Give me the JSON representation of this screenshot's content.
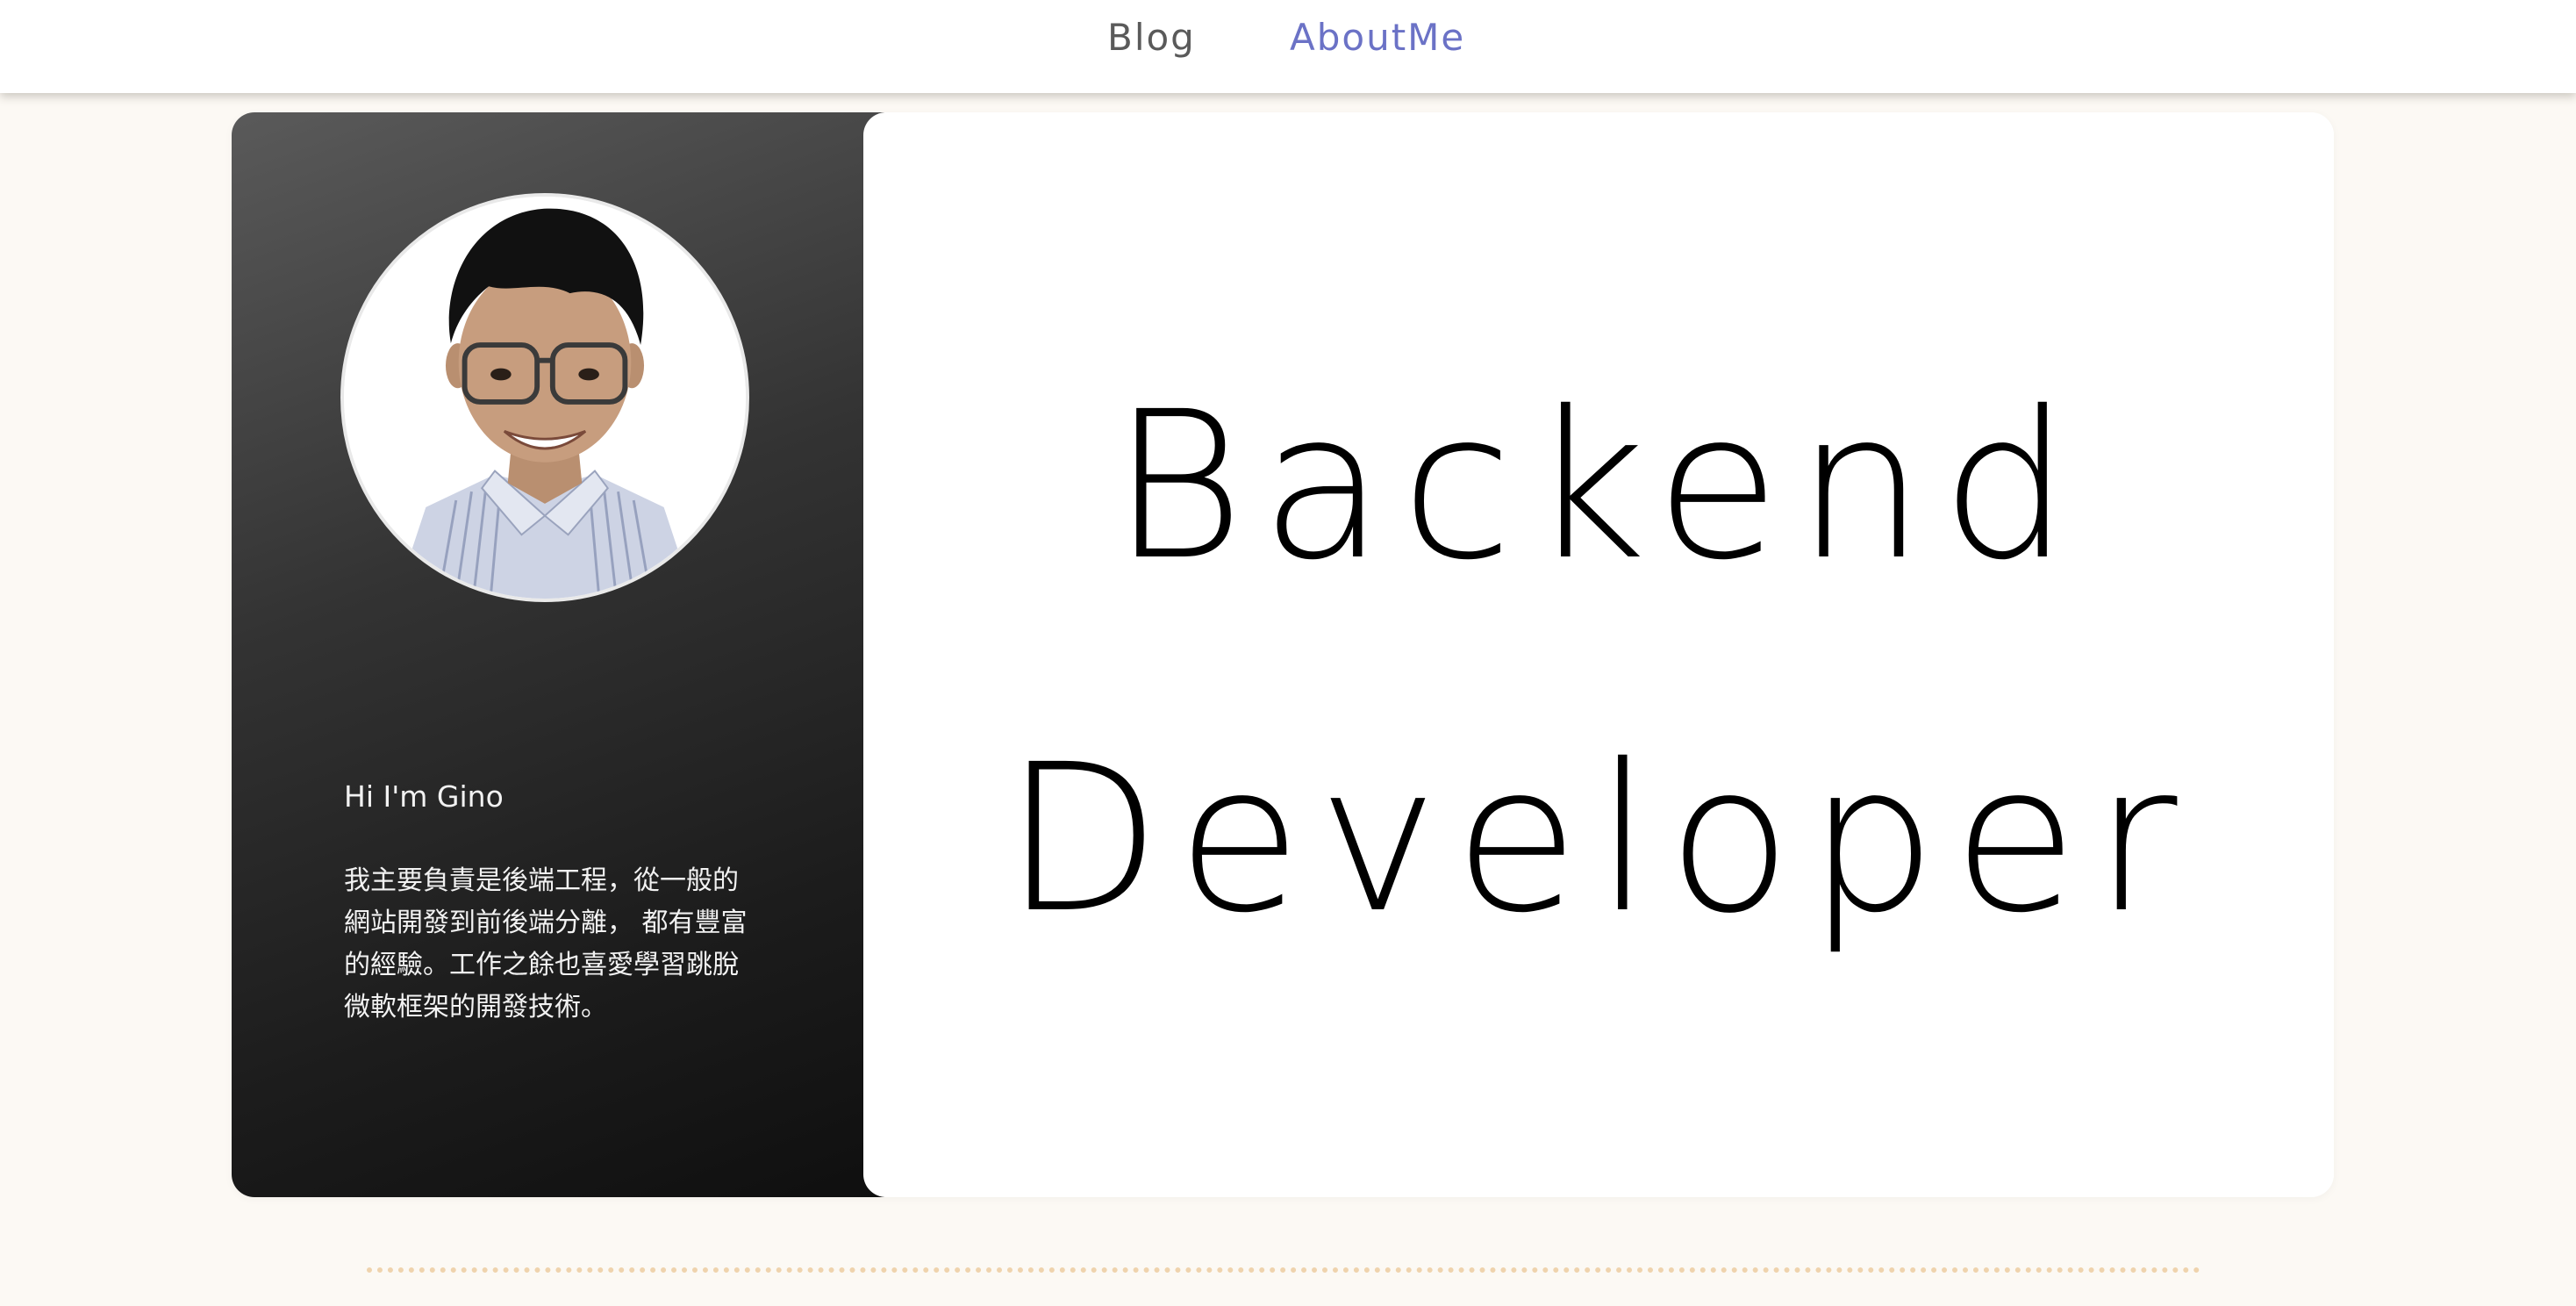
{
  "nav": {
    "blog_label": "Blog",
    "about_label": "AboutMe",
    "active_color": "#6b72c6",
    "inactive_color": "#5a5a5a"
  },
  "profile": {
    "greeting": "Hi I'm Gino",
    "bio": "我主要負責是後端工程，從一般的網站開發到前後端分離， 都有豐富的經驗。工作之餘也喜愛學習跳脫微軟框架的開發技術。",
    "avatar_icon": "profile-photo"
  },
  "headline": {
    "line1": "Backend",
    "line2": "Developer"
  },
  "colors": {
    "page_background": "#fcf9f4",
    "sidebar_gradient_start": "#5a5a5a",
    "sidebar_gradient_end": "#0f0f0f",
    "divider": "#efd3ad"
  }
}
